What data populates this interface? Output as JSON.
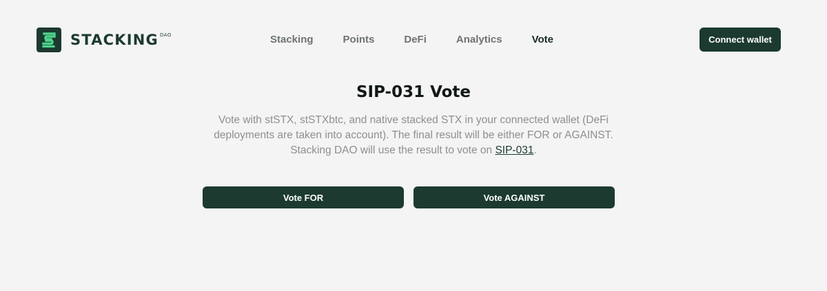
{
  "header": {
    "logo": {
      "text": "STACKING",
      "sup": "DAO"
    },
    "nav": [
      {
        "label": "Stacking",
        "active": false
      },
      {
        "label": "Points",
        "active": false
      },
      {
        "label": "DeFi",
        "active": false
      },
      {
        "label": "Analytics",
        "active": false
      },
      {
        "label": "Vote",
        "active": true
      }
    ],
    "connect_label": "Connect wallet"
  },
  "main": {
    "title": "SIP-031 Vote",
    "description_before": "Vote with stSTX, stSTXbtc, and native stacked STX in your connected wallet (DeFi deployments are taken into account). The final result will be either FOR or AGAINST. Stacking DAO will use the result to vote on ",
    "description_link": "SIP-031",
    "description_after": ".",
    "vote_for_label": "Vote FOR",
    "vote_against_label": "Vote AGAINST"
  },
  "colors": {
    "background": "#f4f4f4",
    "brand_dark": "#1c3a30",
    "brand_green": "#4fd38a",
    "nav_inactive": "#6d7370",
    "description": "#8c908e"
  },
  "icons": {
    "logo": "stacking-dao-s-logo-icon"
  }
}
